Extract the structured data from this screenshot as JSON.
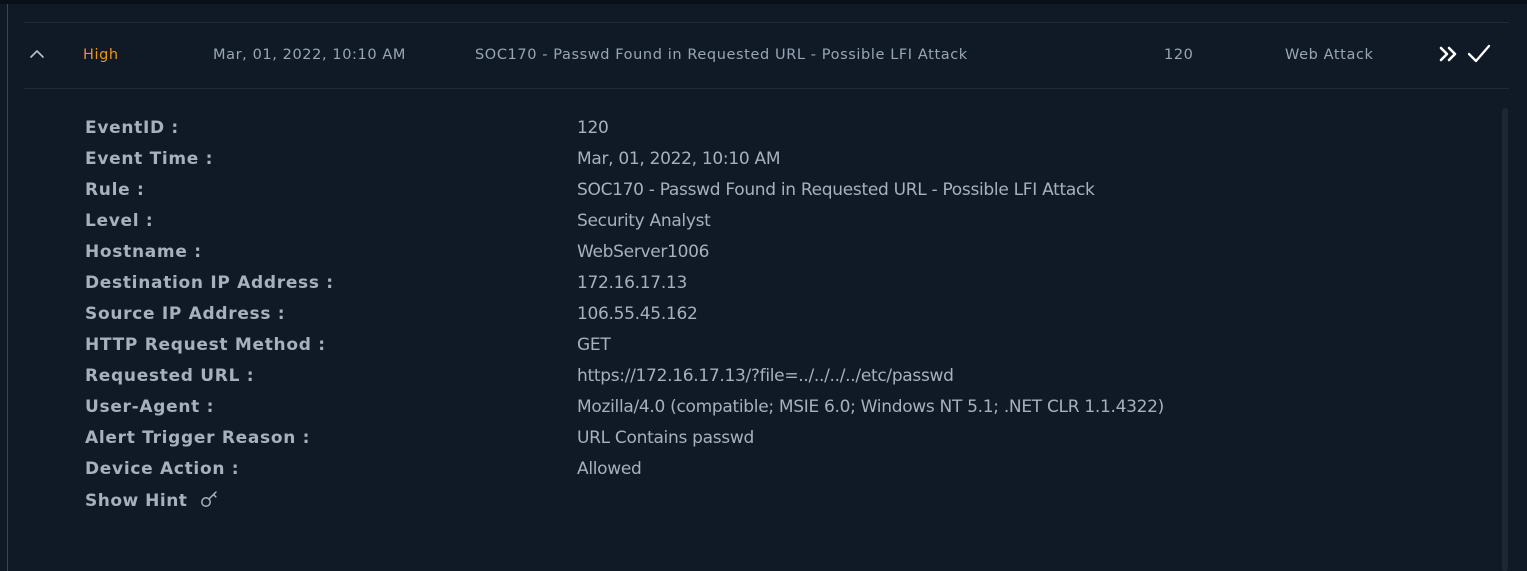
{
  "alert": {
    "severity": "High",
    "datetime": "Mar, 01, 2022, 10:10 AM",
    "rule": "SOC170 - Passwd Found in Requested URL - Possible LFI Attack",
    "event_id": "120",
    "type": "Web Attack"
  },
  "details": [
    {
      "label": "EventID :",
      "value": "120"
    },
    {
      "label": "Event Time :",
      "value": "Mar, 01, 2022, 10:10 AM"
    },
    {
      "label": "Rule :",
      "value": "SOC170 - Passwd Found in Requested URL - Possible LFI Attack"
    },
    {
      "label": "Level :",
      "value": "Security Analyst"
    },
    {
      "label": "Hostname :",
      "value": "WebServer1006"
    },
    {
      "label": "Destination IP Address :",
      "value": "172.16.17.13"
    },
    {
      "label": "Source IP Address :",
      "value": "106.55.45.162"
    },
    {
      "label": "HTTP Request Method :",
      "value": "GET"
    },
    {
      "label": "Requested URL :",
      "value": "https://172.16.17.13/?file=../../../../etc/passwd"
    },
    {
      "label": "User-Agent :",
      "value": "Mozilla/4.0 (compatible; MSIE 6.0; Windows NT 5.1; .NET CLR 1.1.4322)"
    },
    {
      "label": "Alert Trigger Reason :",
      "value": "URL Contains passwd"
    },
    {
      "label": "Device Action :",
      "value": "Allowed"
    }
  ],
  "hint": {
    "label": "Show Hint"
  },
  "icons": {
    "collapse": "chevron-up-icon",
    "forward": "double-chevron-right-icon",
    "check": "check-icon",
    "hint": "key-icon"
  },
  "colors": {
    "severity_high": "#e8951f",
    "background": "#101a27"
  }
}
